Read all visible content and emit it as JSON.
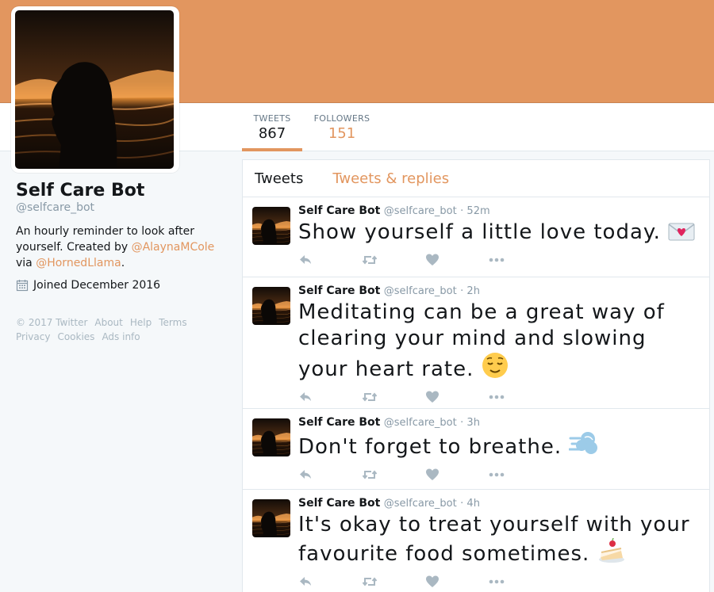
{
  "profile": {
    "name": "Self Care Bot",
    "handle": "@selfcare_bot",
    "bio_part1": "An hourly reminder to look after yourself. Created by ",
    "bio_link1": "@AlaynaMCole",
    "bio_part2": "via ",
    "bio_link2": "@HornedLlama",
    "bio_end": ".",
    "joined": "Joined December 2016"
  },
  "stats": {
    "tweets_label": "TWEETS",
    "tweets_value": "867",
    "followers_label": "FOLLOWERS",
    "followers_value": "151"
  },
  "footer": [
    "© 2017 Twitter",
    "About",
    "Help",
    "Terms",
    "Privacy",
    "Cookies",
    "Ads info"
  ],
  "timeline": {
    "tab_active": "Tweets",
    "tab_other": "Tweets & replies"
  },
  "tweets": [
    {
      "name": "Self Care Bot",
      "handle": "@selfcare_bot",
      "time": "· 52m",
      "text": "Show yourself a little love today.",
      "emoji": "love-letter-icon"
    },
    {
      "name": "Self Care Bot",
      "handle": "@selfcare_bot",
      "time": "· 2h",
      "text": "Meditating can be a great way of clearing your mind and slowing your heart rate.",
      "emoji": "relieved-face-icon"
    },
    {
      "name": "Self Care Bot",
      "handle": "@selfcare_bot",
      "time": "· 3h",
      "text": "Don't forget to breathe.",
      "emoji": "dash-icon"
    },
    {
      "name": "Self Care Bot",
      "handle": "@selfcare_bot",
      "time": "· 4h",
      "text": "It's okay to treat yourself with your favourite food sometimes.",
      "emoji": "cake-icon"
    }
  ],
  "colors": {
    "accent": "#e2965f",
    "muted": "#8899a6",
    "icon": "#aab8c2"
  }
}
